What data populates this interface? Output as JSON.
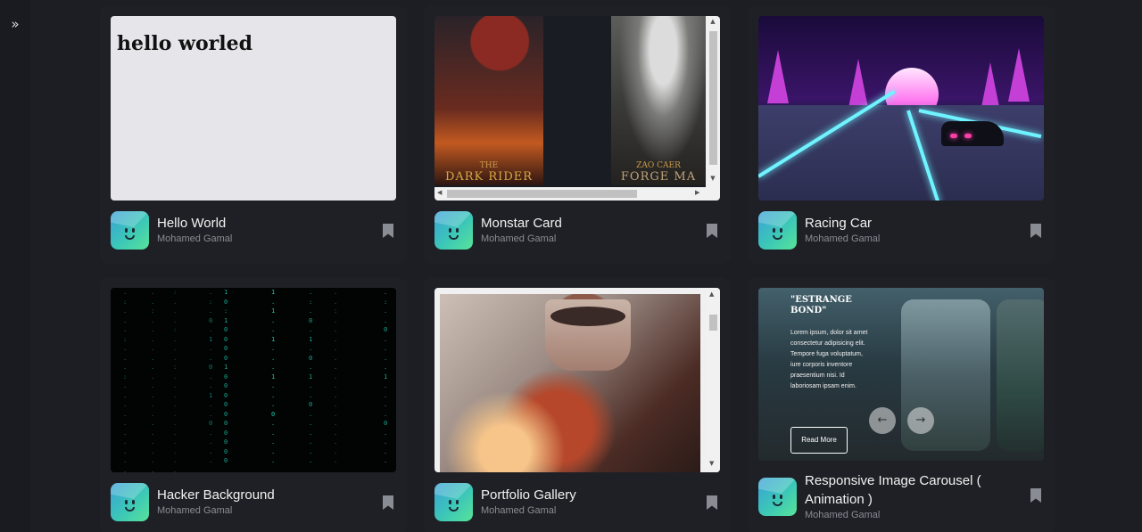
{
  "sidebar": {
    "expand_icon": "double-chevron-right-icon",
    "expand_glyph": "»"
  },
  "cards": [
    {
      "title": "Hello World",
      "author": "Mohamed Gamal",
      "preview_text": "hello worled"
    },
    {
      "title": "Monstar Card",
      "author": "Mohamed Gamal",
      "preview_captions": [
        "THE",
        "DARK RIDER",
        "ZAO CAER",
        "FORGE MA"
      ]
    },
    {
      "title": "Racing Car",
      "author": "Mohamed Gamal"
    },
    {
      "title": "Hacker Background",
      "author": "Mohamed Gamal"
    },
    {
      "title": "Portfolio Gallery",
      "author": "Mohamed Gamal"
    },
    {
      "title": "Responsive Image Carousel ( Animation )",
      "author": "Mohamed Gamal",
      "carousel": {
        "heading": "\"ESTRANGE BOND\"",
        "body": "Lorem ipsum, dolor sit amet consectetur adipisicing elit. Tempore fuga voluptatum, iure corporis inventore praesentium nisi. Id laboriosam ipsam enim.",
        "button": "Read More",
        "prev": "←",
        "next": "→"
      }
    }
  ],
  "colors": {
    "background": "#1d1e24",
    "card": "#1f2026",
    "accent": "#3cc7b7"
  }
}
